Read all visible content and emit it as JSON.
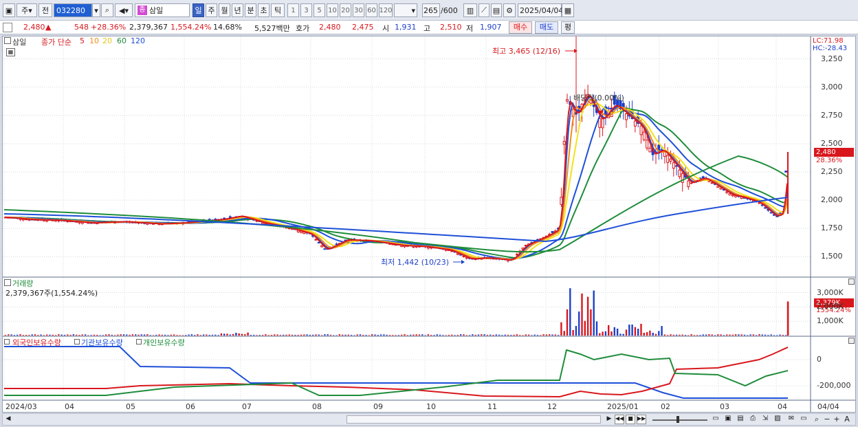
{
  "toolbar": {
    "type_label": "주",
    "prev_label": "전",
    "code": "032280",
    "name": "삼일",
    "name_badge": "종",
    "periods": [
      "일",
      "주",
      "월",
      "년",
      "분",
      "초",
      "틱"
    ],
    "intervals": [
      "1",
      "3",
      "5",
      "10",
      "20",
      "30",
      "60",
      "120"
    ],
    "count": "265",
    "count_total": "/600",
    "date": "2025/04/04"
  },
  "quote": {
    "price": "2,480",
    "change_arrow": "▲",
    "change": "548",
    "change_pct": "+28.36%",
    "volume": "2,379,367",
    "volume_pct": "1,554.24%",
    "turnover": "14.68%",
    "amount": "5,527백만",
    "ask_label": "호가",
    "ask": "2,480",
    "bid": "2,475",
    "open_label": "시",
    "open": "1,931",
    "high_label": "고",
    "high": "2,510",
    "low_label": "저",
    "low": "1,907",
    "buy_label": "매수",
    "sell_label": "매도",
    "avg_label": "평"
  },
  "price_panel": {
    "title": "삼일",
    "ma_label": "종가 단순",
    "ma_periods": [
      "5",
      "10",
      "20",
      "60",
      "120"
    ],
    "ma_colors": [
      "#d8171d",
      "#f28c1c",
      "#f2e21c",
      "#1e8c3a",
      "#1d4fd8"
    ],
    "lc": "LC:71.98",
    "hc": "HC:-28.43",
    "high_note": "최고 3,465 (12/16)",
    "low_note": "최저 1,442 (10/23)",
    "dividend_note": "배당락(0.00%)",
    "price_tag": "2,480",
    "pct_tag": "28.36%",
    "y_ticks": [
      "3,250",
      "3,000",
      "2,750",
      "2,500",
      "2,250",
      "2,000",
      "1,750",
      "1,500"
    ]
  },
  "volume_panel": {
    "title": "거래량",
    "value": "2,379,367주(1,554.24%)",
    "tag": "2,379K",
    "pct": "1554.24%",
    "y_ticks": [
      "3,000K",
      "2,000K",
      "1,000K"
    ]
  },
  "holdings_panel": {
    "legend": [
      "외국인보유수량",
      "기관보유수량",
      "개인보유수량"
    ],
    "colors": [
      "#d8171d",
      "#1d4fd8",
      "#1e8c3a"
    ],
    "y_ticks": [
      "0",
      "-200,000"
    ]
  },
  "x_axis": {
    "labels": [
      "2024/03",
      "04",
      "05",
      "06",
      "07",
      "08",
      "09",
      "10",
      "11",
      "12",
      "2025/01",
      "02",
      "03",
      "04"
    ],
    "last": "04/04"
  }
}
